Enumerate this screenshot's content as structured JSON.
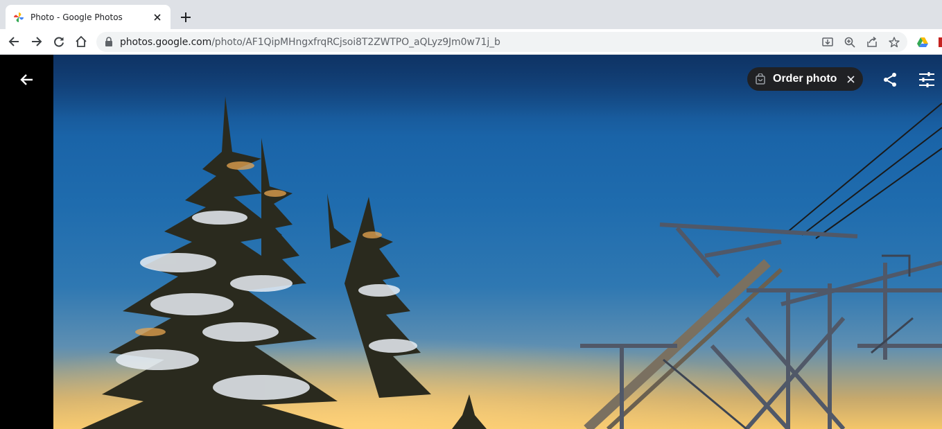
{
  "browser": {
    "tab": {
      "title": "Photo - Google Photos",
      "favicon": "google-photos-pinwheel-icon",
      "close_icon": "close-icon"
    },
    "new_tab_icon": "plus-icon",
    "toolbar": {
      "back_icon": "arrow-left-icon",
      "forward_icon": "arrow-right-icon",
      "reload_icon": "reload-icon",
      "home_icon": "home-icon"
    },
    "omnibox": {
      "lock_icon": "lock-icon",
      "url_host": "photos.google.com",
      "url_path": "/photo/AF1QipMHngxfrqRCjsoi8T2ZWTPO_aQLyz9Jm0w71j_b",
      "right_icons": [
        "install-app-icon",
        "zoom-icon",
        "share-icon",
        "bookmark-star-icon"
      ]
    },
    "extensions": [
      "google-drive-icon",
      "extension-icon"
    ]
  },
  "viewer": {
    "back_icon": "arrow-left-icon",
    "order_photo": {
      "label": "Order photo",
      "icon": "shopping-bag-icon",
      "close_icon": "close-icon"
    },
    "share_icon": "share-icon",
    "edit_icon": "tune-sliders-icon",
    "photo": {
      "subject": "snow-covered fir trees and cable car tower at sunset"
    }
  },
  "colors": {
    "tabstrip": "#dee1e6",
    "omnibox_bg": "#f1f3f4",
    "chip_bg": "#202124",
    "sky_top": "#123f78",
    "sky_mid": "#1f6cae",
    "sunset": "#f4c66a"
  }
}
